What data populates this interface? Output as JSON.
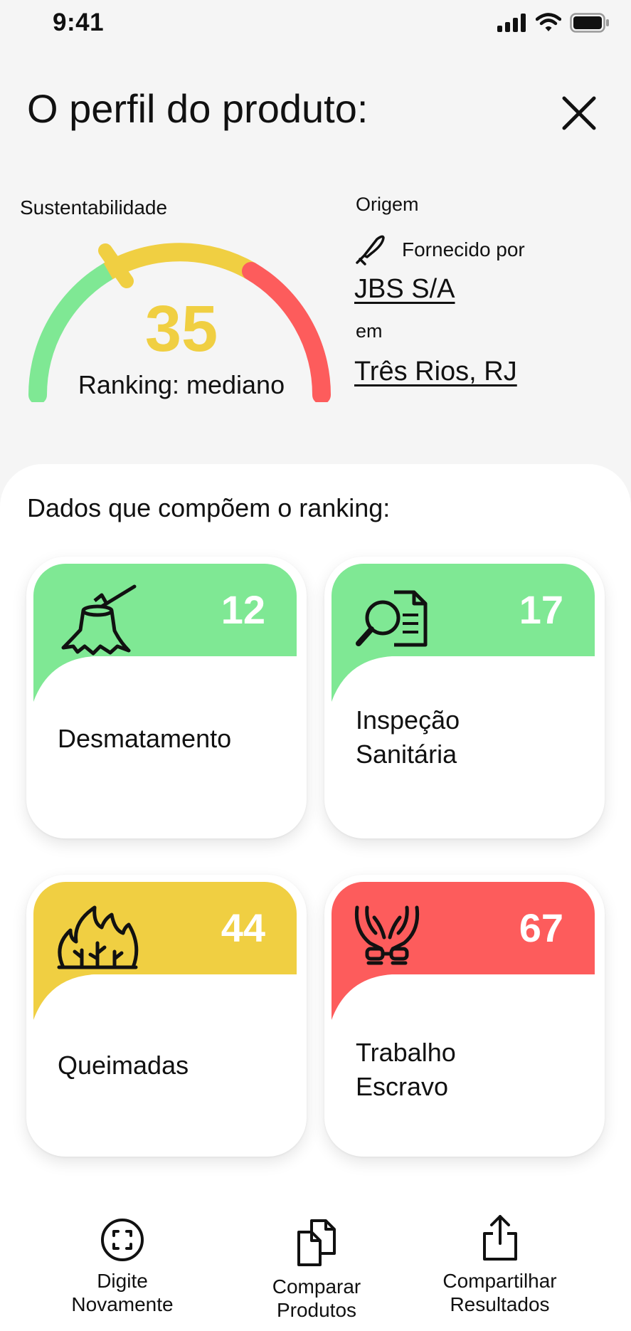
{
  "status_bar": {
    "time": "9:41"
  },
  "header": {
    "title": "O perfil do produto:"
  },
  "gauge": {
    "label": "Sustentabilidade",
    "score": "35",
    "ranking_text": "Ranking: mediano",
    "value_fraction": 0.35,
    "colors": {
      "green": "#7fe894",
      "yellow": "#f0cf42",
      "red": "#fd5c5c"
    }
  },
  "origin": {
    "label": "Origem",
    "supplier_prefix": "Fornecido por",
    "supplier": "JBS S/A",
    "connector": "em",
    "location": "Três Rios, RJ"
  },
  "panel": {
    "title": "Dados que compõem o ranking:",
    "cards": [
      {
        "value": "12",
        "label": "Desmatamento",
        "icon": "tree-stump-axe-icon",
        "color": "#7fe894"
      },
      {
        "value": "17",
        "label": "Inspeção\nSanitária",
        "icon": "document-search-icon",
        "color": "#7fe894"
      },
      {
        "value": "44",
        "label": "Queimadas",
        "icon": "fire-icon",
        "color": "#f0cf42"
      },
      {
        "value": "67",
        "label": "Trabalho\nEscravo",
        "icon": "chained-hands-icon",
        "color": "#fd5c5c"
      }
    ]
  },
  "toolbar": {
    "items": [
      {
        "label": "Digite\nNovamente",
        "icon": "scan-icon"
      },
      {
        "label": "Comparar\nProdutos",
        "icon": "copy-documents-icon"
      },
      {
        "label": "Compartilhar\nResultados",
        "icon": "share-icon"
      }
    ]
  }
}
